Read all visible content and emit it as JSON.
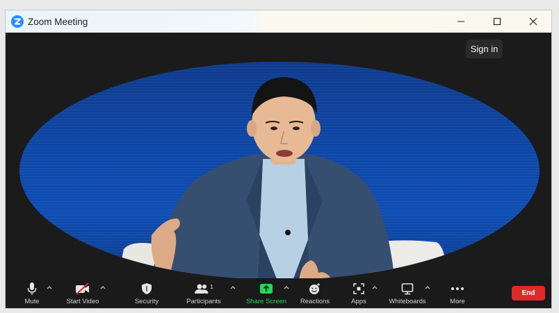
{
  "window": {
    "title": "Zoom Meeting",
    "app_icon": "zoom-logo-icon"
  },
  "controls": {
    "minimize": "minimize-icon",
    "maximize": "maximize-icon",
    "close": "close-icon"
  },
  "sign_in": {
    "label": "Sign in"
  },
  "video": {
    "description_icon": "participant-video"
  },
  "toolbar": {
    "mute": {
      "label": "Mute",
      "icon": "microphone-icon"
    },
    "video": {
      "label": "Start Video",
      "icon": "video-off-icon"
    },
    "security": {
      "label": "Security",
      "icon": "shield-icon"
    },
    "participants": {
      "label": "Participants",
      "count": "1",
      "icon": "people-icon"
    },
    "share": {
      "label": "Share Screen",
      "icon": "share-screen-icon",
      "color": "#23d959"
    },
    "reactions": {
      "label": "Reactions",
      "icon": "emoji-icon"
    },
    "apps": {
      "label": "Apps",
      "icon": "apps-icon"
    },
    "whiteboards": {
      "label": "Whiteboards",
      "icon": "whiteboard-icon"
    },
    "more": {
      "label": "More",
      "icon": "more-icon"
    },
    "end": {
      "label": "End",
      "color": "#e02828"
    }
  }
}
